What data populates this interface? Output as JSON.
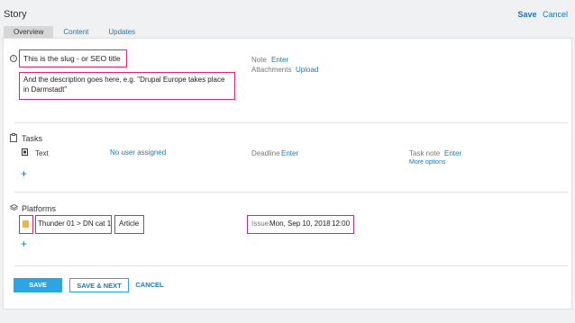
{
  "header": {
    "title": "Story",
    "save_label": "Save",
    "cancel_label": "Cancel"
  },
  "tabs": [
    {
      "label": "Overview",
      "active": true
    },
    {
      "label": "Content",
      "active": false
    },
    {
      "label": "Updates",
      "active": false
    }
  ],
  "overview": {
    "info_icon": "info-icon",
    "slug_title": "This is the slug - or SEO title",
    "description_line1": "And the description goes here, e.g. \"Drupal Europe takes place",
    "description_line2": "in Darmstadt\"",
    "note_label": "Note",
    "note_action": "Enter",
    "attachments_label": "Attachments",
    "attachments_action": "Upload"
  },
  "tasks": {
    "heading": "Tasks",
    "task_icon": "clipboard-icon",
    "items": [
      {
        "type_icon": "text-doc-icon",
        "name": "Text",
        "assignee": "No user assigned",
        "deadline_label": "Deadline",
        "deadline_action": "Enter",
        "task_note_label": "Task note",
        "task_note_action": "Enter",
        "more_options": "More options"
      }
    ],
    "add_icon": "plus-icon"
  },
  "platforms": {
    "heading": "Platforms",
    "platforms_icon": "layers-icon",
    "items": [
      {
        "flag_icon": "flag-icon",
        "path": "Thunder 01  >  DN cat 1",
        "type": "Article",
        "issue_label": "Issue",
        "issue_date": "Mon, Sep 10, 2018",
        "issue_time": "12:00"
      }
    ],
    "add_icon": "plus-icon"
  },
  "footer": {
    "save_label": "SAVE",
    "save_next_label": "SAVE & NEXT",
    "cancel_label": "CANCEL"
  },
  "colors": {
    "accent": "#1a79b6",
    "primary_button": "#2aa6e6",
    "highlight": "#e0227a",
    "page_bg": "#f0f1f3"
  }
}
